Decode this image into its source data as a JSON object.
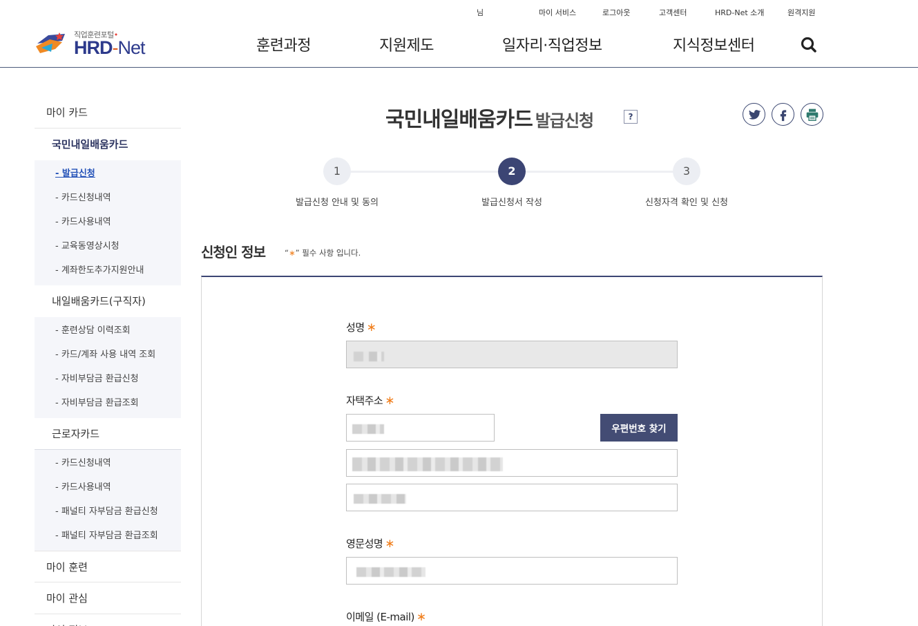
{
  "header": {
    "user_suffix": "님",
    "util_links": [
      "마이 서비스",
      "로그아웃",
      "고객센터",
      "HRD-Net 소개",
      "원격지원"
    ],
    "logo_sub": "직업훈련포털",
    "logo_main": "HRD",
    "logo_dash": "-",
    "logo_net": "Net",
    "gnb": [
      "훈련과정",
      "지원제도",
      "일자리·직업정보",
      "지식정보센터"
    ]
  },
  "sidebar": {
    "my_card": "마이 카드",
    "groups": [
      {
        "label": "국민내일배움카드",
        "items": [
          "- 발급신청",
          "- 카드신청내역",
          "- 카드사용내역",
          "- 교육동영상시청",
          "- 계좌한도추가지원안내"
        ]
      },
      {
        "label": "내일배움카드(구직자)",
        "items": [
          "- 훈련상담 이력조회",
          "- 카드/계좌 사용 내역 조회",
          "- 자비부담금 환급신청",
          "- 자비부담금 환급조회"
        ]
      },
      {
        "label": "근로자카드",
        "items": [
          "- 카드신청내역",
          "- 카드사용내역",
          "- 패널티 자부담금 환급신청",
          "- 패널티 자부담금 환급조회"
        ]
      }
    ],
    "my_training": "마이 훈련",
    "my_interest": "마이 관심",
    "my_info": "마이 정보"
  },
  "page": {
    "title_main": "국민내일배움카드",
    "title_sub": "발급신청",
    "help": "?"
  },
  "steps": [
    {
      "num": "1",
      "label": "발급신청 안내 및 동의"
    },
    {
      "num": "2",
      "label": "발급신청서 작성"
    },
    {
      "num": "3",
      "label": "신청자격 확인 및 신청"
    }
  ],
  "section": {
    "title": "신청인 정보",
    "note_open": "“",
    "note_star": "∗",
    "note_close": "” 필수 사항 입니다."
  },
  "form": {
    "name_label": "성명",
    "address_label": "자택주소",
    "zip_button": "우편번호 찾기",
    "eng_name_label": "영문성명",
    "email_label": "이메일 (E-mail)",
    "required_mark": "∗"
  },
  "colors": {
    "primary": "#3c4574",
    "required": "#f07d1a",
    "active_link": "#2452b8"
  }
}
